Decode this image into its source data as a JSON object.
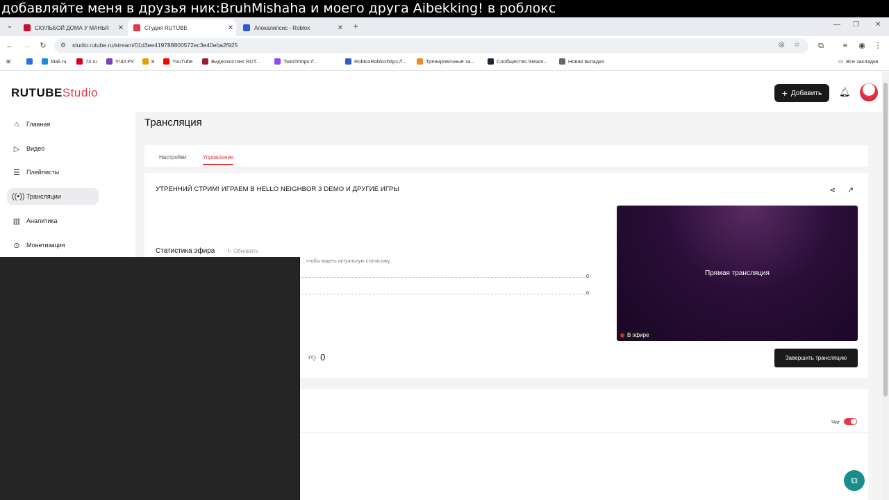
{
  "overlay_banner": {
    "text": "добавляйте меня в друзья ник:BruhMishaha и моего друга Aibekking! в роблокс"
  },
  "browser": {
    "tabs": [
      {
        "title": "СКУЛЬБОЙ ДОМА У МАНЬЯ",
        "favicon_color": "#c8102e",
        "active": false
      },
      {
        "title": "Студия RUTUBE",
        "favicon_color": "#e63946",
        "active": true
      },
      {
        "title": "Апокалипсис - Roblox",
        "favicon_color": "#335acc",
        "active": false
      }
    ],
    "url": "studio.rutube.ru/stream/01d3ee419788800572ec3e40eba2f925",
    "bookmarks": [
      {
        "label": "",
        "favicon_color": "#2f6de1"
      },
      {
        "label": "Mail.ru",
        "favicon_color": "#168de2"
      },
      {
        "label": "74.ru",
        "favicon_color": "#d6001c"
      },
      {
        "label": "УЧИ.РУ",
        "favicon_color": "#7b3fbf"
      },
      {
        "label": "8",
        "favicon_color": "#e5a100"
      },
      {
        "label": "YouTube",
        "favicon_color": "#ff0000"
      },
      {
        "label": "Видеохостинг RUT...",
        "favicon_color": "#9b1c31"
      },
      {
        "label": "Twitchhttps://...",
        "favicon_color": "#9146ff"
      },
      {
        "label": "RobloxRobloxhttps://...",
        "favicon_color": "#335acc"
      },
      {
        "label": "Тренировочные за...",
        "favicon_color": "#f08a24"
      },
      {
        "label": "Сообщество Steam...",
        "favicon_color": "#1b2838"
      },
      {
        "label": "Новая вкладка",
        "favicon_color": "#666666"
      }
    ],
    "all_bookmarks": "Все закладки"
  },
  "header": {
    "logo_main": "RUTUBE",
    "logo_sub": "Studio",
    "add_label": "Добавить"
  },
  "sidebar": {
    "items": [
      {
        "label": "Главная",
        "icon": "home-icon",
        "active": false
      },
      {
        "label": "Видео",
        "icon": "video-icon",
        "active": false
      },
      {
        "label": "Плейлисты",
        "icon": "playlist-icon",
        "active": false
      },
      {
        "label": "Трансляции",
        "icon": "broadcast-icon",
        "active": true
      },
      {
        "label": "Аналитика",
        "icon": "analytics-icon",
        "active": false
      },
      {
        "label": "Монетизация",
        "icon": "money-icon",
        "active": false
      }
    ]
  },
  "main": {
    "page_title": "Трансляция",
    "tabs": [
      {
        "label": "Настройки",
        "active": false
      },
      {
        "label": "Управление",
        "active": true
      }
    ],
    "stream_title": "УТРЕННИЙ СТРИМ! ИГРАЕМ В HELLO NEIGHBOR 3 DEMO И ДРУГИЕ ИГРЫ",
    "stats_label": "Статистика эфира",
    "refresh_label": "Обновить",
    "stats_hint": ", чтобы видеть актуальную статистику",
    "stat_values": [
      "0",
      "0"
    ],
    "dislikes": "0",
    "player_text": "Прямая трансляция",
    "live_badge": "В эфире",
    "end_button": "Завершить трансляцию",
    "chat_label": "Чат",
    "chat_enabled": true
  },
  "colors": {
    "accent": "#e63946",
    "dark": "#1a1a1a",
    "fab": "#1a8c8c"
  }
}
